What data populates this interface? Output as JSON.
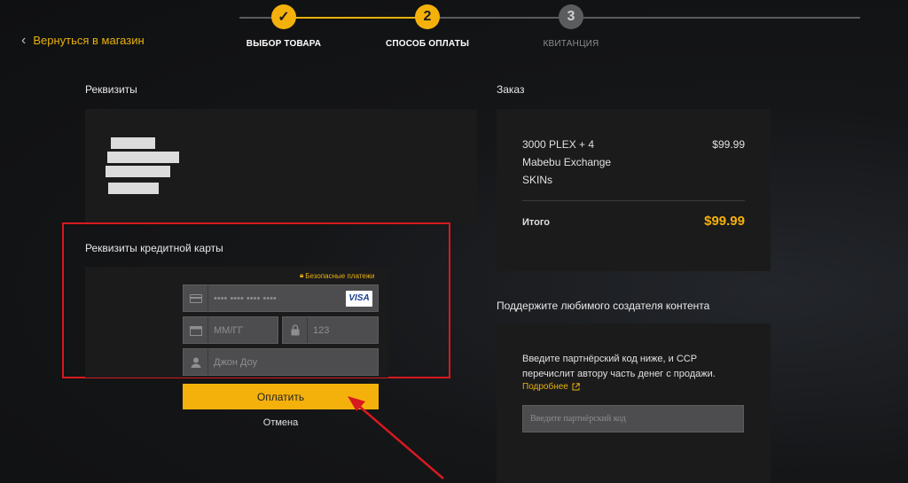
{
  "header": {
    "back_label": "Вернуться в магазин",
    "steps": [
      {
        "number": "✓",
        "label": "ВЫБОР ТОВАРА",
        "state": "done"
      },
      {
        "number": "2",
        "label": "СПОСОБ ОПЛАТЫ",
        "state": "active"
      },
      {
        "number": "3",
        "label": "КВИТАНЦИЯ",
        "state": "pending"
      }
    ]
  },
  "details": {
    "title": "Реквизиты",
    "card_section_title": "Реквизиты кредитной карты",
    "secure_label": "Безопасные платежи",
    "card_number_placeholder": "•••• •••• •••• ••••",
    "card_brand": "VISA",
    "expiry_placeholder": "ММ/ГГ",
    "cvv_placeholder": "123",
    "name_placeholder": "Джон Доу",
    "pay_label": "Оплатить",
    "cancel_label": "Отмена"
  },
  "order": {
    "title": "Заказ",
    "item_lines": [
      "3000 PLEX + 4",
      "Mabebu Exchange",
      "SKINs"
    ],
    "item_price": "$99.99",
    "total_label": "Итого",
    "total_value": "$99.99"
  },
  "support": {
    "title": "Поддержите любимого создателя контента",
    "description_lines": [
      "Введите партнёрский код ниже, и CCP",
      "перечислит автору часть денег с продажи."
    ],
    "more_link": "Подробнее",
    "code_placeholder": "Введите партнёрский код"
  },
  "colors": {
    "accent": "#f5b10b",
    "annotation_red": "#d71920",
    "pending_step": "#5b5c5e"
  }
}
